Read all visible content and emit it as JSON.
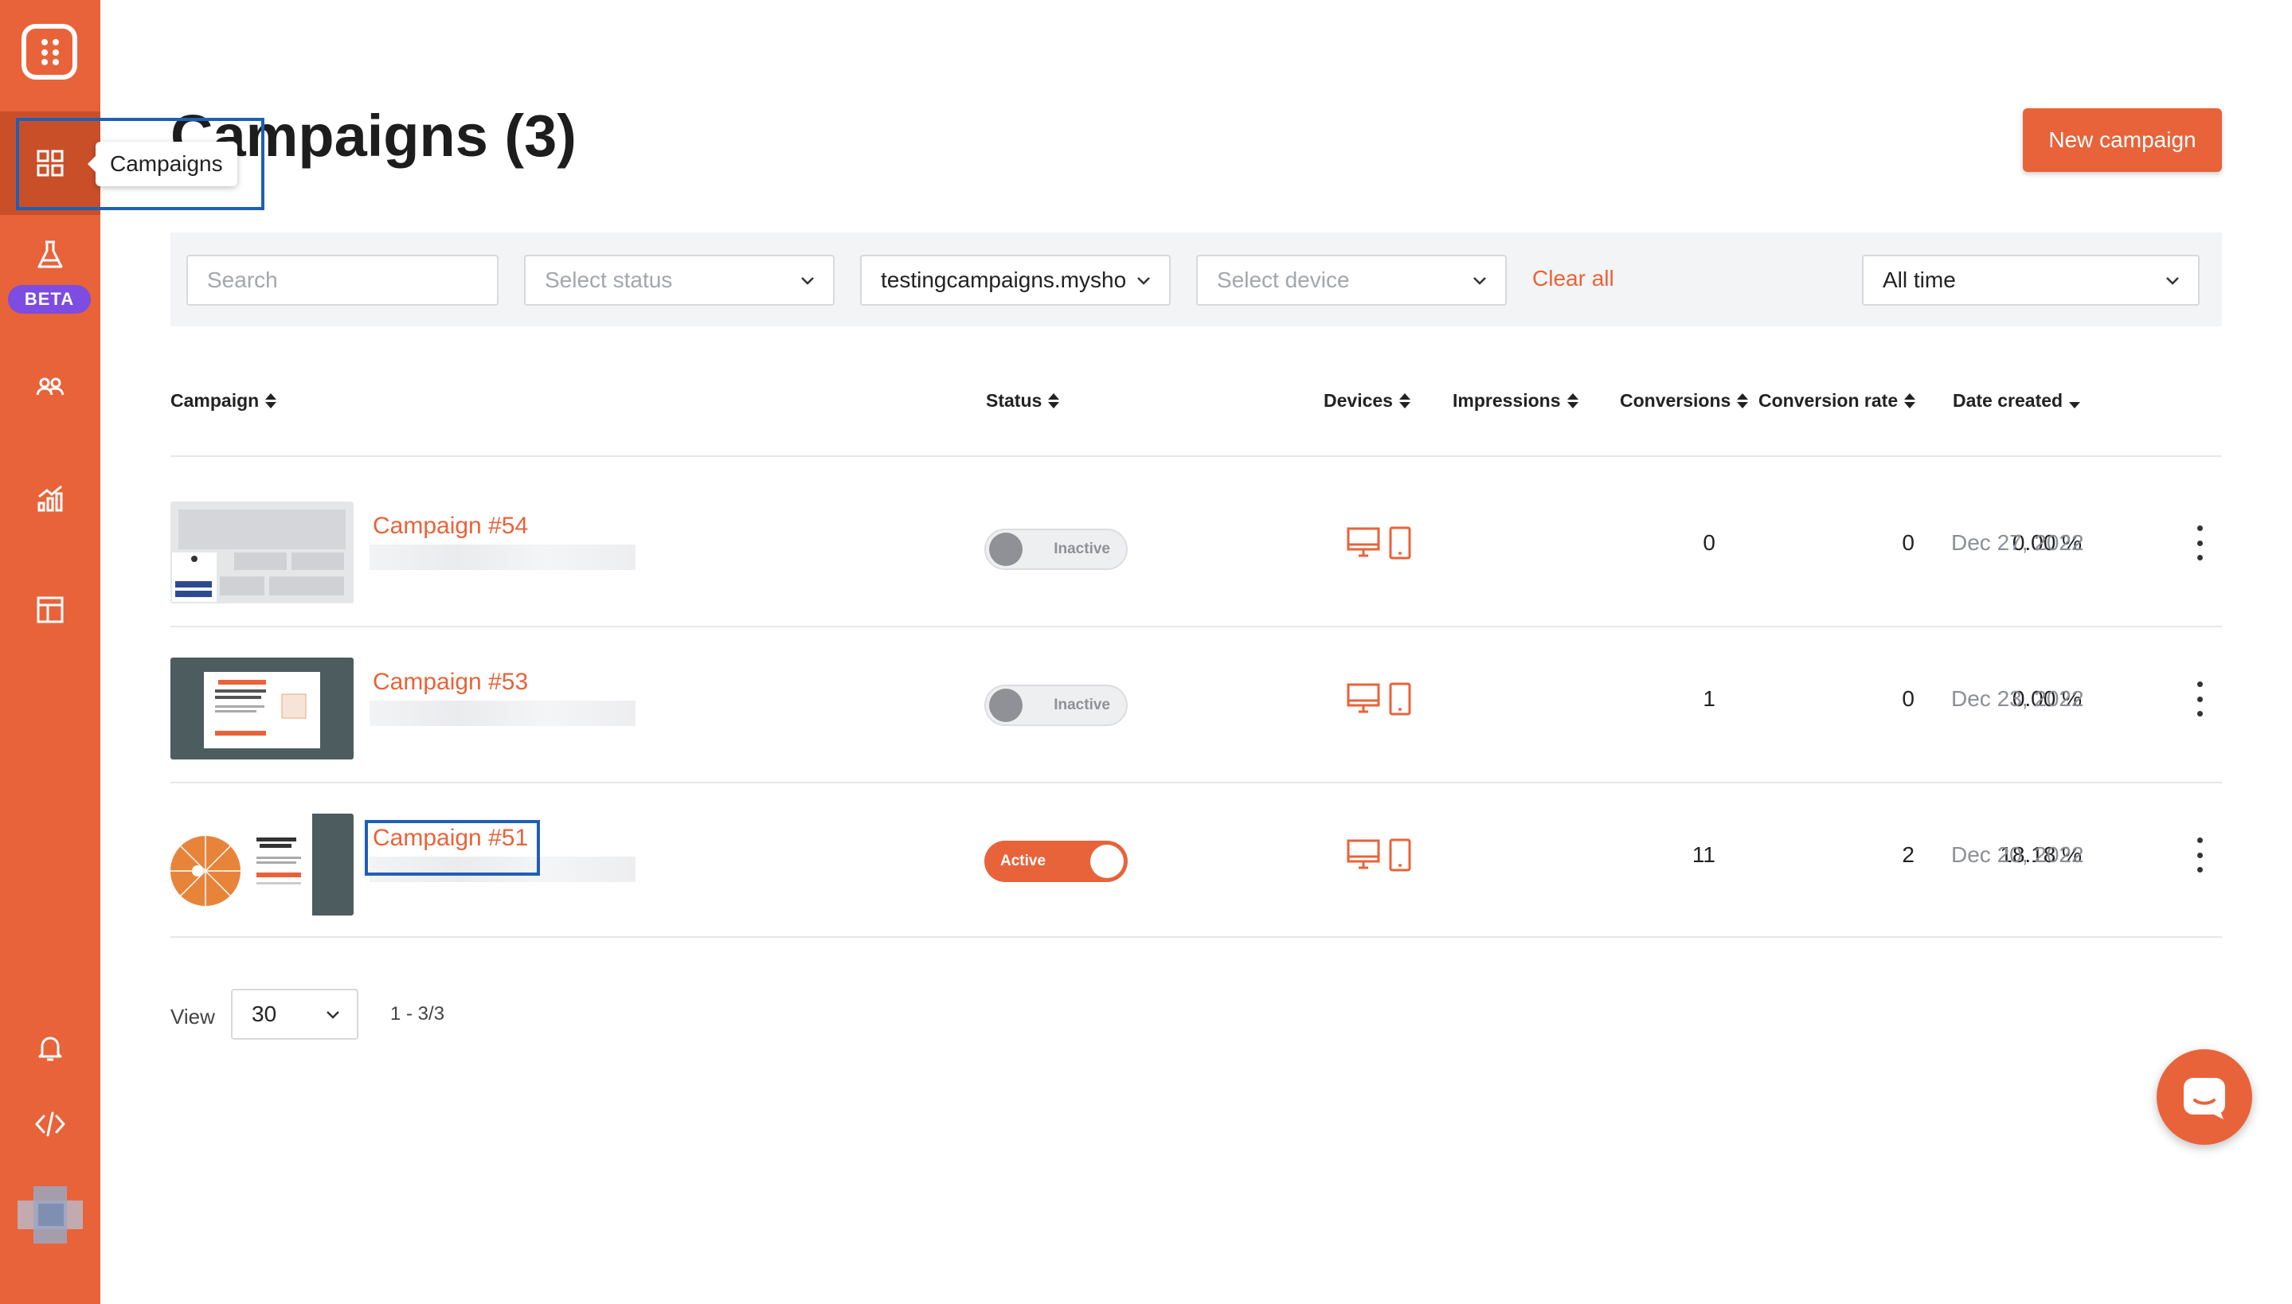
{
  "app": {
    "brand_color": "#e8633a",
    "sidebar": {
      "items": [
        {
          "name": "campaigns",
          "icon": "grid-icon",
          "active": true
        },
        {
          "name": "experiments",
          "icon": "flask-icon",
          "badge": "BETA"
        },
        {
          "name": "audience",
          "icon": "users-icon"
        },
        {
          "name": "analytics",
          "icon": "chart-icon"
        },
        {
          "name": "templates",
          "icon": "layout-icon"
        },
        {
          "name": "notifications",
          "icon": "bell-icon"
        },
        {
          "name": "integration-code",
          "icon": "code-icon"
        }
      ],
      "tooltip": "Campaigns"
    }
  },
  "header": {
    "title": "Campaigns (3)",
    "new_button": "New campaign"
  },
  "filters": {
    "search_placeholder": "Search",
    "status_placeholder": "Select status",
    "domain_value": "testingcampaigns.mysho",
    "device_placeholder": "Select device",
    "clear_all": "Clear all",
    "time_value": "All time"
  },
  "table": {
    "columns": [
      "Campaign",
      "Status",
      "Devices",
      "Impressions",
      "Conversions",
      "Conversion rate",
      "Date created"
    ],
    "sorted_column": "Date created",
    "rows": [
      {
        "name": "Campaign #54",
        "status": "Inactive",
        "active": false,
        "impressions": "0",
        "conversions": "0",
        "rate": "0.00 %",
        "date": "Dec 27, 2022"
      },
      {
        "name": "Campaign #53",
        "status": "Inactive",
        "active": false,
        "impressions": "1",
        "conversions": "0",
        "rate": "0.00 %",
        "date": "Dec 23, 2022"
      },
      {
        "name": "Campaign #51",
        "status": "Active",
        "active": true,
        "impressions": "11",
        "conversions": "2",
        "rate": "18.18 %",
        "date": "Dec 20, 2022"
      }
    ]
  },
  "pagination": {
    "view_label": "View",
    "page_size": "30",
    "range": "1 - 3/3"
  }
}
